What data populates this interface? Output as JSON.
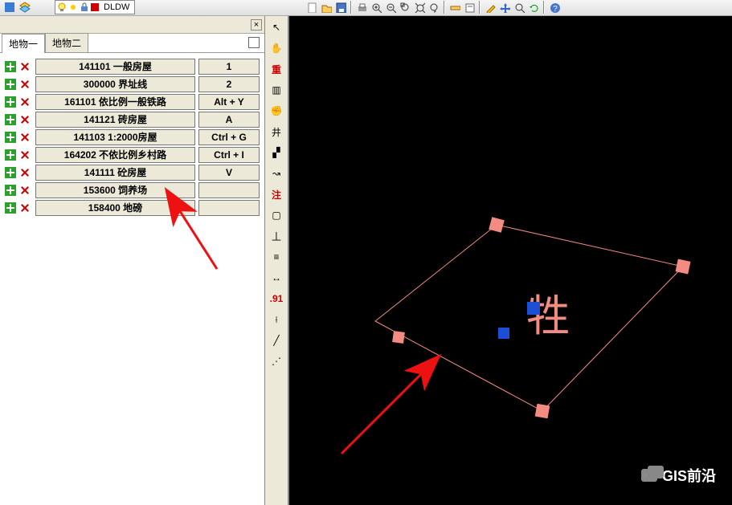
{
  "top": {
    "layer_text": "DLDW"
  },
  "panel": {
    "tabs": [
      {
        "label": "地物一",
        "active": true
      },
      {
        "label": "地物二",
        "active": false
      }
    ],
    "rows": [
      {
        "label": "141101 一般房屋",
        "key": "1"
      },
      {
        "label": "300000 界址线",
        "key": "2"
      },
      {
        "label": "161101 依比例一般铁路",
        "key": "Alt + Y"
      },
      {
        "label": "141121 砖房屋",
        "key": "A"
      },
      {
        "label": "141103 1:2000房屋",
        "key": "Ctrl + G"
      },
      {
        "label": "164202 不依比例乡村路",
        "key": "Ctrl + I"
      },
      {
        "label": "141111 砼房屋",
        "key": "V"
      },
      {
        "label": "153600 饲养场",
        "key": ""
      },
      {
        "label": "158400 地磅",
        "key": ""
      }
    ]
  },
  "vstrip": {
    "items": [
      {
        "name": "cursor-icon",
        "glyph": "↖",
        "cls": ""
      },
      {
        "name": "hand-icon",
        "glyph": "✋",
        "cls": ""
      },
      {
        "name": "chong-label",
        "glyph": "重",
        "cls": "redtxt"
      },
      {
        "name": "layers2-icon",
        "glyph": "▥",
        "cls": ""
      },
      {
        "name": "hand2-icon",
        "glyph": "✊",
        "cls": ""
      },
      {
        "name": "grid-icon",
        "glyph": "井",
        "cls": ""
      },
      {
        "name": "chart-icon",
        "glyph": "▞",
        "cls": ""
      },
      {
        "name": "curve-icon",
        "glyph": "↝",
        "cls": ""
      },
      {
        "name": "zhu-label",
        "glyph": "注",
        "cls": "redtxt"
      },
      {
        "name": "box-icon",
        "glyph": "▢",
        "cls": ""
      },
      {
        "name": "ruler-icon",
        "glyph": "丄",
        "cls": ""
      },
      {
        "name": "bars-icon",
        "glyph": "≡",
        "cls": ""
      },
      {
        "name": "dim-icon",
        "glyph": "↔",
        "cls": ""
      },
      {
        "name": "scale-label",
        "glyph": ".91",
        "cls": "redtxt"
      },
      {
        "name": "seg-icon",
        "glyph": "⟊",
        "cls": ""
      },
      {
        "name": "dash-icon",
        "glyph": "╱",
        "cls": ""
      },
      {
        "name": "dashline-icon",
        "glyph": "⋰",
        "cls": ""
      }
    ]
  },
  "canvas": {
    "char": "牲"
  },
  "watermark": "GIS前沿"
}
